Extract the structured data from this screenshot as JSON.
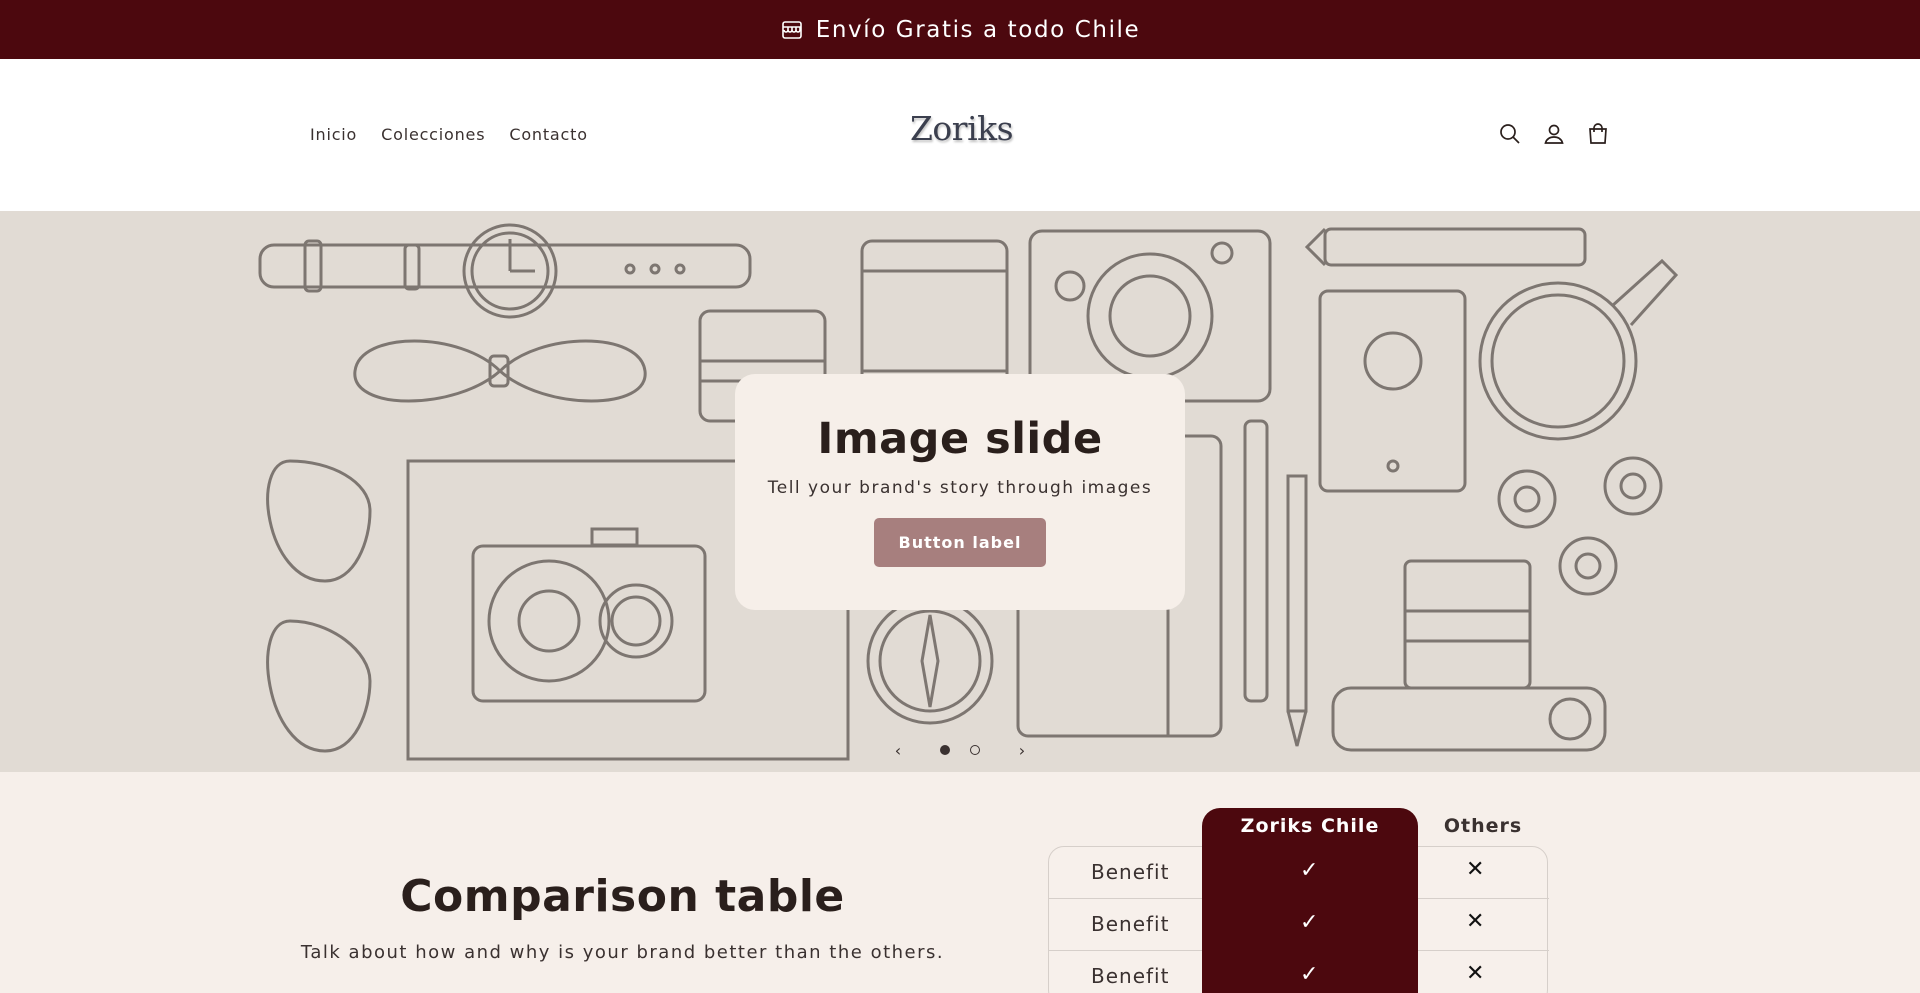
{
  "announcement": {
    "text": "Envío Gratis a todo Chile",
    "icon": "store-icon"
  },
  "header": {
    "logo": "Zoriks",
    "nav": [
      {
        "label": "Inicio"
      },
      {
        "label": "Colecciones"
      },
      {
        "label": "Contacto"
      }
    ],
    "icons": [
      "search-icon",
      "account-icon",
      "cart-icon"
    ]
  },
  "hero": {
    "title": "Image slide",
    "subtitle": "Tell your brand's story through images",
    "button_label": "Button label",
    "prev_icon": "chevron-left-icon",
    "next_icon": "chevron-right-icon",
    "slides_count": 2,
    "active_slide": 1
  },
  "comparison": {
    "title": "Comparison table",
    "subtitle": "Talk about how and why is your brand better than the others.",
    "col_brand": "Zoriks Chile",
    "col_others": "Others",
    "rows": [
      {
        "label": "Benefit",
        "brand": "✓",
        "others": "✕"
      },
      {
        "label": "Benefit",
        "brand": "✓",
        "others": "✕"
      },
      {
        "label": "Benefit",
        "brand": "✓",
        "others": "✕"
      }
    ]
  },
  "colors": {
    "brand_dark": "#4c080e",
    "button": "#a77f7e",
    "hero_bg": "#e1dbd4",
    "page_bg": "#f6efea"
  }
}
